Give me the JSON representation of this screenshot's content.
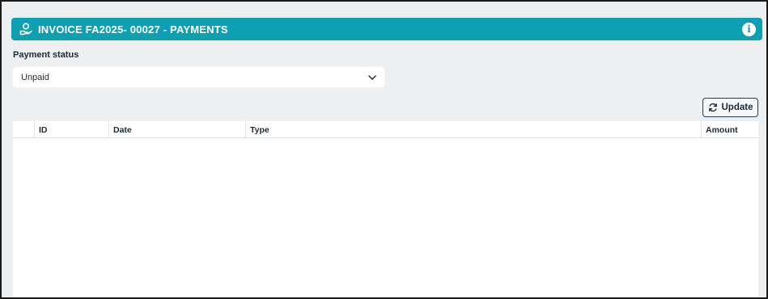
{
  "header": {
    "title": "INVOICE FA2025- 00027 - PAYMENTS",
    "icon": "hand-coin-icon",
    "info_icon": "info-icon",
    "info_glyph": "i",
    "accent_color": "#0f9fb3"
  },
  "payment_status": {
    "label": "Payment status",
    "selected": "Unpaid"
  },
  "toolbar": {
    "update_label": "Update"
  },
  "table": {
    "columns": [
      "",
      "ID",
      "Date",
      "Type",
      "Amount"
    ],
    "rows": []
  }
}
